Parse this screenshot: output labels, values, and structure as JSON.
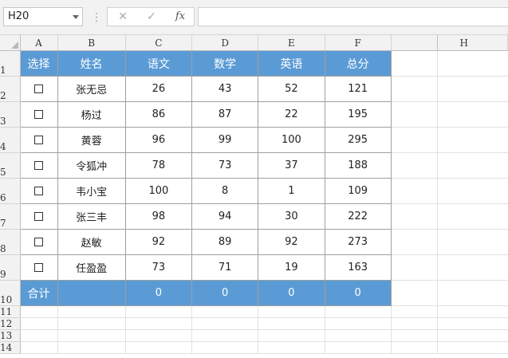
{
  "name_box": "H20",
  "formula_bar": {
    "separator": "⋮",
    "cancel_symbol": "✕",
    "enter_symbol": "✓",
    "fx_label": "fx",
    "content": ""
  },
  "columns": [
    "A",
    "B",
    "C",
    "D",
    "E",
    "F",
    "",
    "H"
  ],
  "header_row": {
    "row_number": "1",
    "cells": [
      "选择",
      "姓名",
      "语文",
      "数学",
      "英语",
      "总分"
    ]
  },
  "data_rows": [
    {
      "row_number": "2",
      "name": "张无忌",
      "chinese": "26",
      "math": "43",
      "english": "52",
      "total": "121"
    },
    {
      "row_number": "3",
      "name": "杨过",
      "chinese": "86",
      "math": "87",
      "english": "22",
      "total": "195"
    },
    {
      "row_number": "4",
      "name": "黄蓉",
      "chinese": "96",
      "math": "99",
      "english": "100",
      "total": "295"
    },
    {
      "row_number": "5",
      "name": "令狐冲",
      "chinese": "78",
      "math": "73",
      "english": "37",
      "total": "188"
    },
    {
      "row_number": "6",
      "name": "韦小宝",
      "chinese": "100",
      "math": "8",
      "english": "1",
      "total": "109"
    },
    {
      "row_number": "7",
      "name": "张三丰",
      "chinese": "98",
      "math": "94",
      "english": "30",
      "total": "222"
    },
    {
      "row_number": "8",
      "name": "赵敏",
      "chinese": "92",
      "math": "89",
      "english": "92",
      "total": "273"
    },
    {
      "row_number": "9",
      "name": "任盈盈",
      "chinese": "73",
      "math": "71",
      "english": "19",
      "total": "163"
    }
  ],
  "total_row": {
    "row_number": "10",
    "label": "合计",
    "chinese": "0",
    "math": "0",
    "english": "0",
    "total": "0"
  },
  "blank_rows": [
    "11",
    "12",
    "13",
    "14"
  ],
  "colors": {
    "header_fill": "#5b9bd5",
    "header_text": "#ffffff",
    "gridline": "#9f9f9f"
  }
}
